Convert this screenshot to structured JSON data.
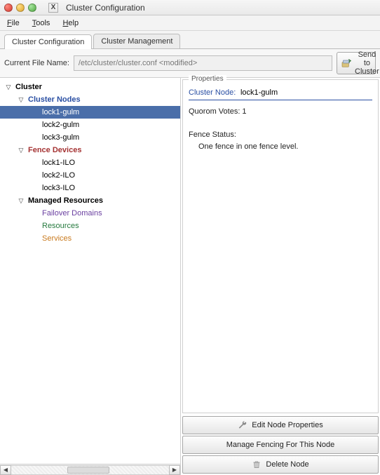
{
  "window": {
    "title": "Cluster Configuration"
  },
  "menubar": {
    "file": "File",
    "tools": "Tools",
    "help": "Help"
  },
  "tabs": {
    "config": "Cluster Configuration",
    "manage": "Cluster Management"
  },
  "filerow": {
    "label": "Current File Name:",
    "value": "/etc/cluster/cluster.conf <modified>",
    "send": "Send to Cluster"
  },
  "tree": {
    "root": "Cluster",
    "nodes_cat": "Cluster Nodes",
    "nodes": [
      "lock1-gulm",
      "lock2-gulm",
      "lock3-gulm"
    ],
    "fence_cat": "Fence Devices",
    "fences": [
      "lock1-ILO",
      "lock2-ILO",
      "lock3-ILO"
    ],
    "managed_cat": "Managed Resources",
    "managed": {
      "failover": "Failover Domains",
      "resources": "Resources",
      "services": "Services"
    }
  },
  "properties": {
    "legend": "Properties",
    "title_label": "Cluster Node:",
    "title_value": "lock1-gulm",
    "quorum_label": "Quorom Votes: 1",
    "fence_label": "Fence Status:",
    "fence_value": "One fence in one fence level."
  },
  "actions": {
    "edit": "Edit Node Properties",
    "fence": "Manage Fencing For This Node",
    "delete": "Delete Node"
  }
}
